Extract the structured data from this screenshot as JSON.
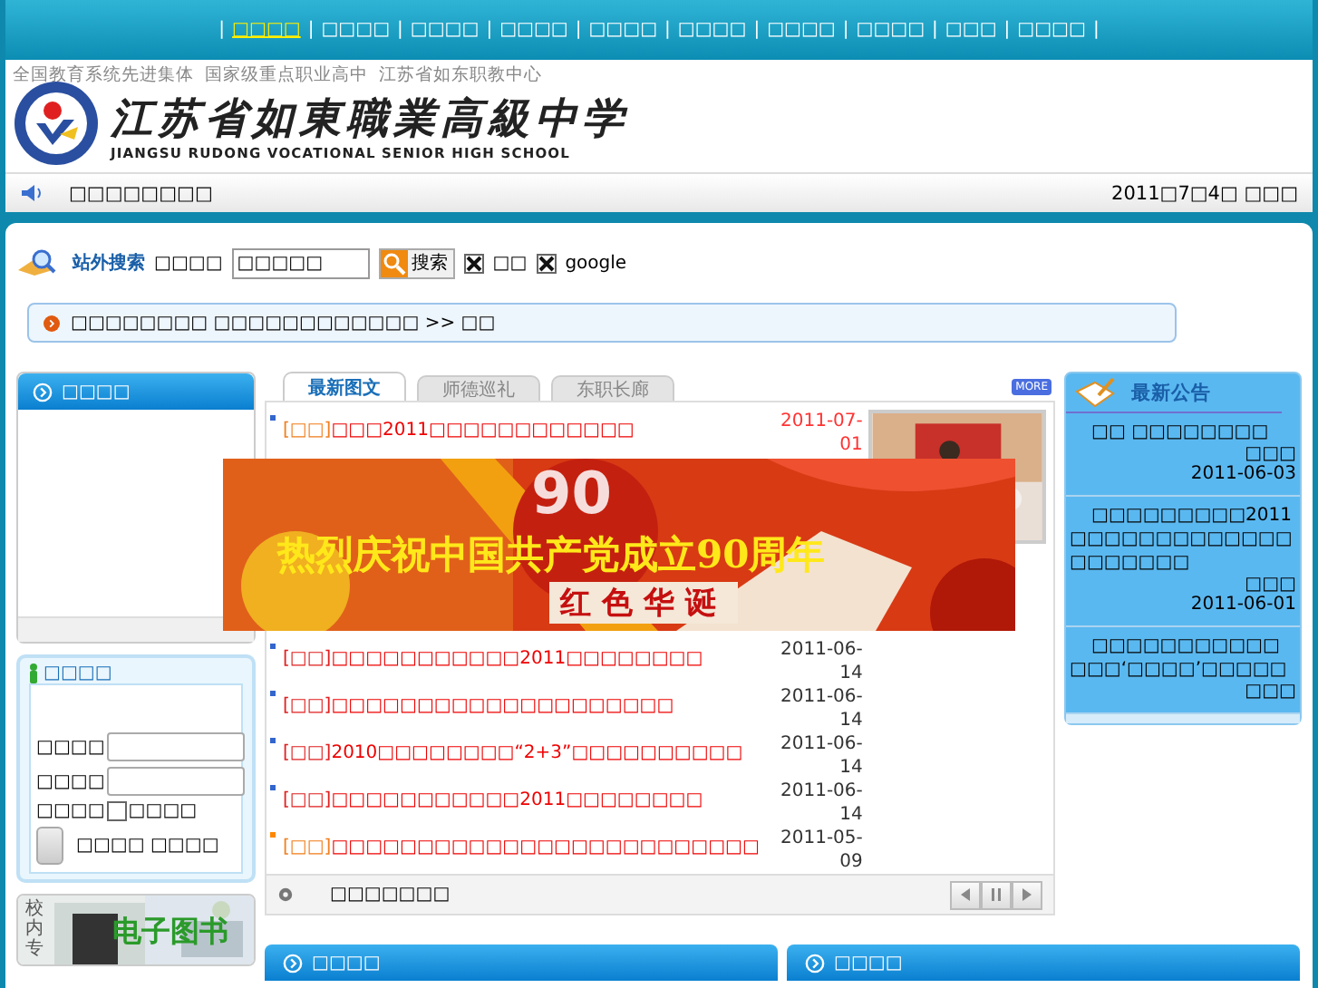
{
  "nav_separator": "|",
  "nav": [
    {
      "label": "□□□□",
      "selected": true
    },
    {
      "label": "□□□□",
      "selected": false
    },
    {
      "label": "□□□□",
      "selected": false
    },
    {
      "label": "□□□□",
      "selected": false
    },
    {
      "label": "□□□□",
      "selected": false
    },
    {
      "label": "□□□□",
      "selected": false
    },
    {
      "label": "□□□□",
      "selected": false
    },
    {
      "label": "□□□□",
      "selected": false
    },
    {
      "label": "□□□",
      "selected": false
    },
    {
      "label": "□□□□",
      "selected": false
    }
  ],
  "header": {
    "tagline": "全国教育系统先进集体  国家级重点职业高中  江苏省如东职教中心",
    "school_name": "江苏省如東職業高級中学",
    "school_name_en": "JIANGSU RUDONG VOCATIONAL SENIOR HIGH SCHOOL"
  },
  "info_bar": {
    "message": "□□□□□□□□",
    "date": "2011□7□4□ □□□"
  },
  "search": {
    "title": "站外搜索",
    "label": "□□□□",
    "value": "□□□□□",
    "button": "搜索",
    "options": [
      {
        "label": "□□",
        "checked": true
      },
      {
        "label": "google",
        "checked": true
      }
    ]
  },
  "breadcrumb": "□□□□□□□□ □□□□□□□□□□□□ >> □□",
  "left_panel": {
    "title": "□□□□"
  },
  "login": {
    "title": "□□□□",
    "fields": [
      {
        "label": "□□□□"
      },
      {
        "label": "□□□□"
      }
    ],
    "remember": {
      "label": "□□□□",
      "option": "□□□□",
      "checked": false
    },
    "button_text": "□□□□ □□□□"
  },
  "ebook_banner": {
    "side_text": "校内专",
    "title": "电子图书"
  },
  "news": {
    "tabs": [
      {
        "label": "最新图文",
        "selected": true
      },
      {
        "label": "师德巡礼",
        "selected": false
      },
      {
        "label": "东职长廊",
        "selected": false
      }
    ],
    "more": "MORE",
    "items": [
      {
        "tag": "[□□]",
        "title": "□□□2011□□□□□□□□□□□□",
        "date": "2011-07-01",
        "highlight": true,
        "color": "#3366cc"
      },
      {
        "tag": "[□□]",
        "title": "□□□□□□□□□□□2011□□□□□□□□",
        "date": "2011-06-14",
        "highlight": false,
        "color": "#3366cc"
      },
      {
        "tag": "[□□]",
        "title": "□□□□□□□□□□□□□□□□□□□□",
        "date": "2011-06-14",
        "highlight": false,
        "color": "#3366cc"
      },
      {
        "tag": "[□□]",
        "title": "2010□□□□□□□□“2+3”□□□□□□□□□□",
        "date": "2011-06-14",
        "highlight": false,
        "color": "#3366cc"
      },
      {
        "tag": "[□□]",
        "title": "□□□□□□□□□□□2011□□□□□□□□",
        "date": "2011-06-14",
        "highlight": false,
        "color": "#3366cc"
      },
      {
        "tag": "[□□]",
        "title": "□□□□□□□□□□□□□□□□□□□□□□□□□",
        "date": "2011-05-09",
        "highlight": false,
        "color": "#ff8800"
      }
    ],
    "caption": "□□□□□□□"
  },
  "notices": {
    "title": "最新公告",
    "items": [
      {
        "text": "□□ □□□□□□□□",
        "author": "□□□",
        "date": "2011-06-03"
      },
      {
        "text": "□□□□□□□□□2011□□□□□□□□□□□□□□□□□□□□",
        "author": "□□□",
        "date": "2011-06-01"
      },
      {
        "text": "□□□□□□□□□□□□□□‘□□□□’□□□□□",
        "author": "□□□"
      }
    ]
  },
  "bottom_panels": [
    "□□□□",
    "□□□□"
  ],
  "float_banner": {
    "headline": "热烈庆祝中国共产党成立90周年",
    "number": "90",
    "subtitle": "红色华诞"
  }
}
